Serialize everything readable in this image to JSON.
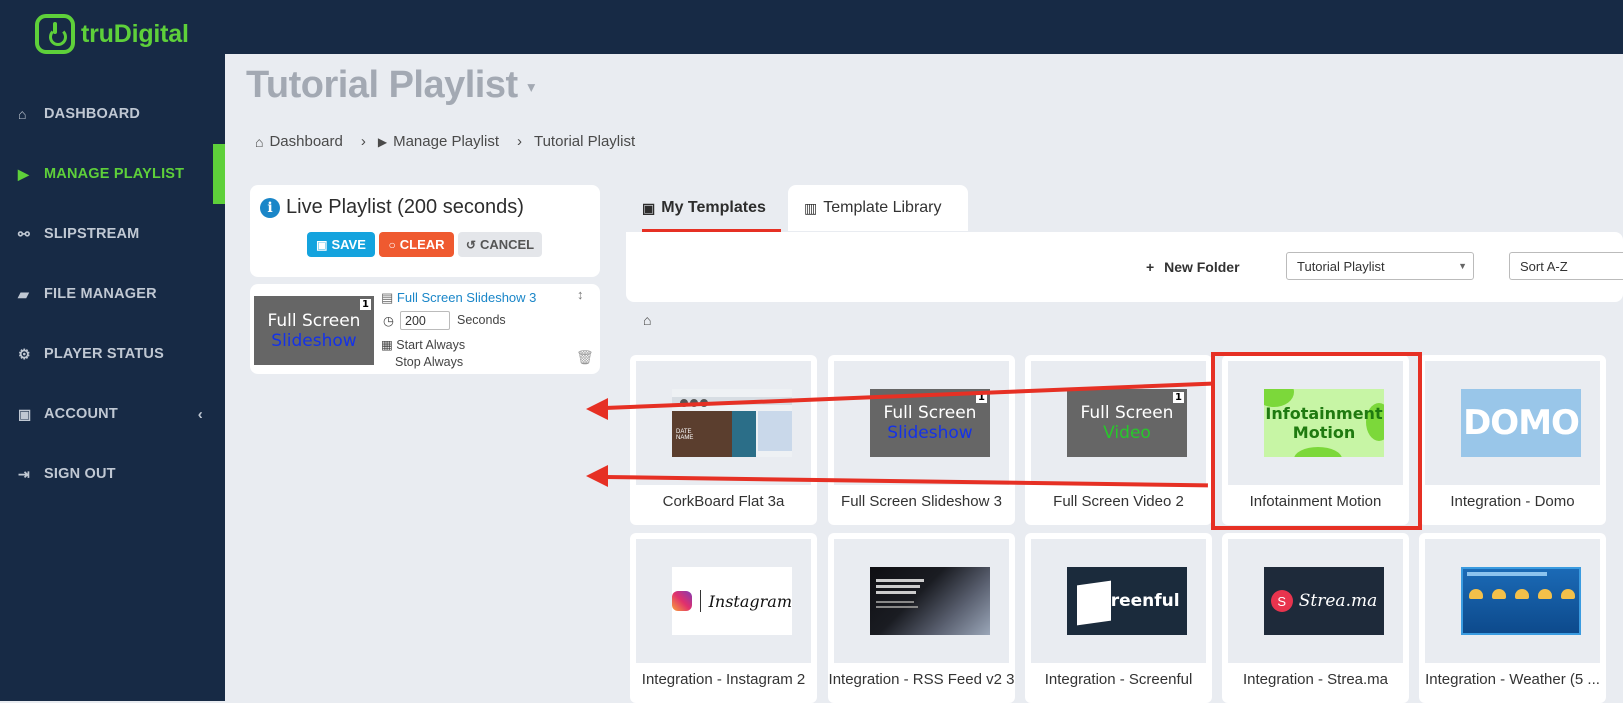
{
  "brand": {
    "name": "truDigital",
    "accent": "#5ed03a"
  },
  "sidebar": {
    "items": [
      {
        "label": "DASHBOARD",
        "icon": "home-icon"
      },
      {
        "label": "MANAGE PLAYLIST",
        "icon": "play-icon",
        "active": true
      },
      {
        "label": "SLIPSTREAM",
        "icon": "sitemap-icon"
      },
      {
        "label": "FILE MANAGER",
        "icon": "folder-icon"
      },
      {
        "label": "PLAYER STATUS",
        "icon": "gears-icon"
      },
      {
        "label": "ACCOUNT",
        "icon": "briefcase-icon"
      },
      {
        "label": "SIGN OUT",
        "icon": "sign-out-icon"
      }
    ]
  },
  "header": {
    "title": "Tutorial Playlist"
  },
  "breadcrumb": [
    "Dashboard",
    "Manage Playlist",
    "Tutorial Playlist"
  ],
  "live": {
    "title": "Live Playlist (200 seconds)",
    "save": "SAVE",
    "clear": "CLEAR",
    "cancel": "CANCEL",
    "item": {
      "name": "Full Screen Slideshow 3",
      "thumb_line1": "Full Screen",
      "thumb_line2": "Slideshow",
      "badge": "1",
      "duration": "200",
      "duration_unit": "Seconds",
      "start": "Start Always",
      "stop": "Stop Always"
    }
  },
  "tabs": [
    {
      "label": "My Templates",
      "active": true
    },
    {
      "label": "Template Library"
    }
  ],
  "toolbar": {
    "new_folder": "New Folder",
    "folder_select": "Tutorial Playlist",
    "sort_select": "Sort A-Z"
  },
  "templates": {
    "row1": [
      {
        "name": "CorkBoard Flat 3a"
      },
      {
        "name": "Full Screen Slideshow 3",
        "line1": "Full Screen",
        "line2": "Slideshow",
        "badge": "1"
      },
      {
        "name": "Full Screen Video 2",
        "line1": "Full Screen",
        "line2": "Video",
        "badge": "1"
      },
      {
        "name": "Infotainment Motion",
        "line1": "Infotainment",
        "line2": "Motion"
      },
      {
        "name": "Integration - Domo",
        "logo": "DOMO"
      }
    ],
    "row2": [
      {
        "name": "Integration - Instagram 2",
        "logo": "Instagram"
      },
      {
        "name": "Integration - RSS Feed v2 3"
      },
      {
        "name": "Integration - Screenful",
        "logo": "Screenful"
      },
      {
        "name": "Integration - Strea.ma",
        "logo": "Strea.ma"
      },
      {
        "name": "Integration - Weather (5 ..."
      }
    ]
  }
}
